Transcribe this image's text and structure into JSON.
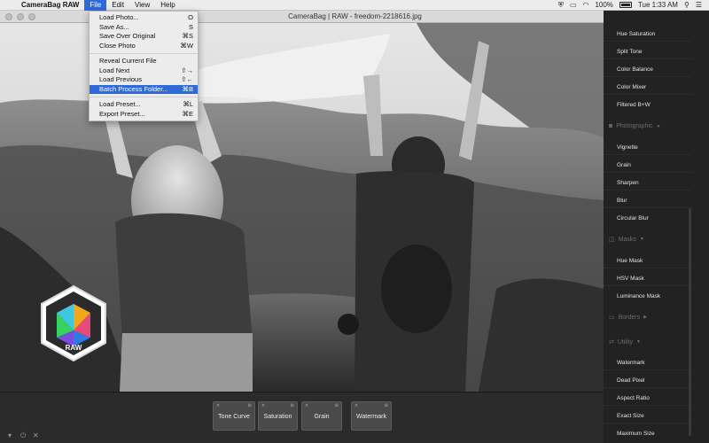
{
  "menubar": {
    "app_name": "CameraBag RAW",
    "menus": [
      "File",
      "Edit",
      "View",
      "Help"
    ],
    "battery": "100%",
    "clock": "Tue 1:33 AM"
  },
  "window": {
    "title": "CameraBag | RAW - freedom-2218616.jpg"
  },
  "file_menu": {
    "groups": [
      [
        {
          "label": "Load Photo...",
          "shortcut": "O"
        },
        {
          "label": "Save As...",
          "shortcut": "S"
        },
        {
          "label": "Save Over Original",
          "shortcut": "⌘S"
        },
        {
          "label": "Close Photo",
          "shortcut": "⌘W"
        }
      ],
      [
        {
          "label": "Reveal Current File",
          "shortcut": ""
        },
        {
          "label": "Load Next",
          "shortcut": "⇧→"
        },
        {
          "label": "Load Previous",
          "shortcut": "⇧←"
        },
        {
          "label": "Batch Process Folder...",
          "shortcut": "⌘B"
        }
      ],
      [
        {
          "label": "Load Preset...",
          "shortcut": "⌘L"
        },
        {
          "label": "Export Preset...",
          "shortcut": "⌘E"
        }
      ]
    ]
  },
  "logo": {
    "text": "RAW"
  },
  "dock": {
    "tiles": [
      "Tone Curve",
      "Saturation",
      "Grain",
      "Watermark"
    ]
  },
  "sidebar": {
    "top_items": [
      "Hue Saturation",
      "Split Tone",
      "Color Balance",
      "Color Mixer",
      "Filtered B+W"
    ],
    "sections": [
      {
        "label": "Photographic",
        "items": [
          "Vignette",
          "Grain",
          "Sharpen",
          "Blur",
          "Circular Blur"
        ]
      },
      {
        "label": "Masks",
        "items": [
          "Hue Mask",
          "HSV Mask",
          "Luminance Mask"
        ]
      },
      {
        "label": "Borders",
        "items": []
      },
      {
        "label": "Utility",
        "items": [
          "Watermark",
          "Dead Pixel",
          "Aspect Ratio",
          "Exact Size",
          "Maximum Size"
        ]
      }
    ]
  },
  "colors": {
    "accent": "#2e6ad8",
    "sidebar_bg": "#222222",
    "dock_bg": "#2b2b2b"
  }
}
